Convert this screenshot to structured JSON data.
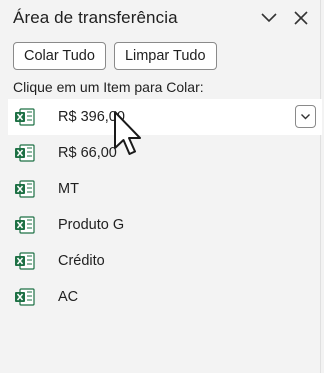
{
  "pane": {
    "title": "Área de transferência",
    "options_icon": "chevron-down-icon",
    "close_icon": "close-icon"
  },
  "actions": {
    "paste_all": "Colar Tudo",
    "clear_all": "Limpar Tudo"
  },
  "instruction": "Clique em um Item para Colar:",
  "items": [
    {
      "label": "R$ 396,00",
      "icon": "excel-icon",
      "selected": true
    },
    {
      "label": "R$ 66,00",
      "icon": "excel-icon"
    },
    {
      "label": "MT",
      "icon": "excel-icon"
    },
    {
      "label": "Produto G",
      "icon": "excel-icon"
    },
    {
      "label": "Crédito",
      "icon": "excel-icon"
    },
    {
      "label": "AC",
      "icon": "excel-icon"
    }
  ],
  "colors": {
    "excel_green": "#1d7044",
    "pane_bg": "#f3f3f3"
  }
}
